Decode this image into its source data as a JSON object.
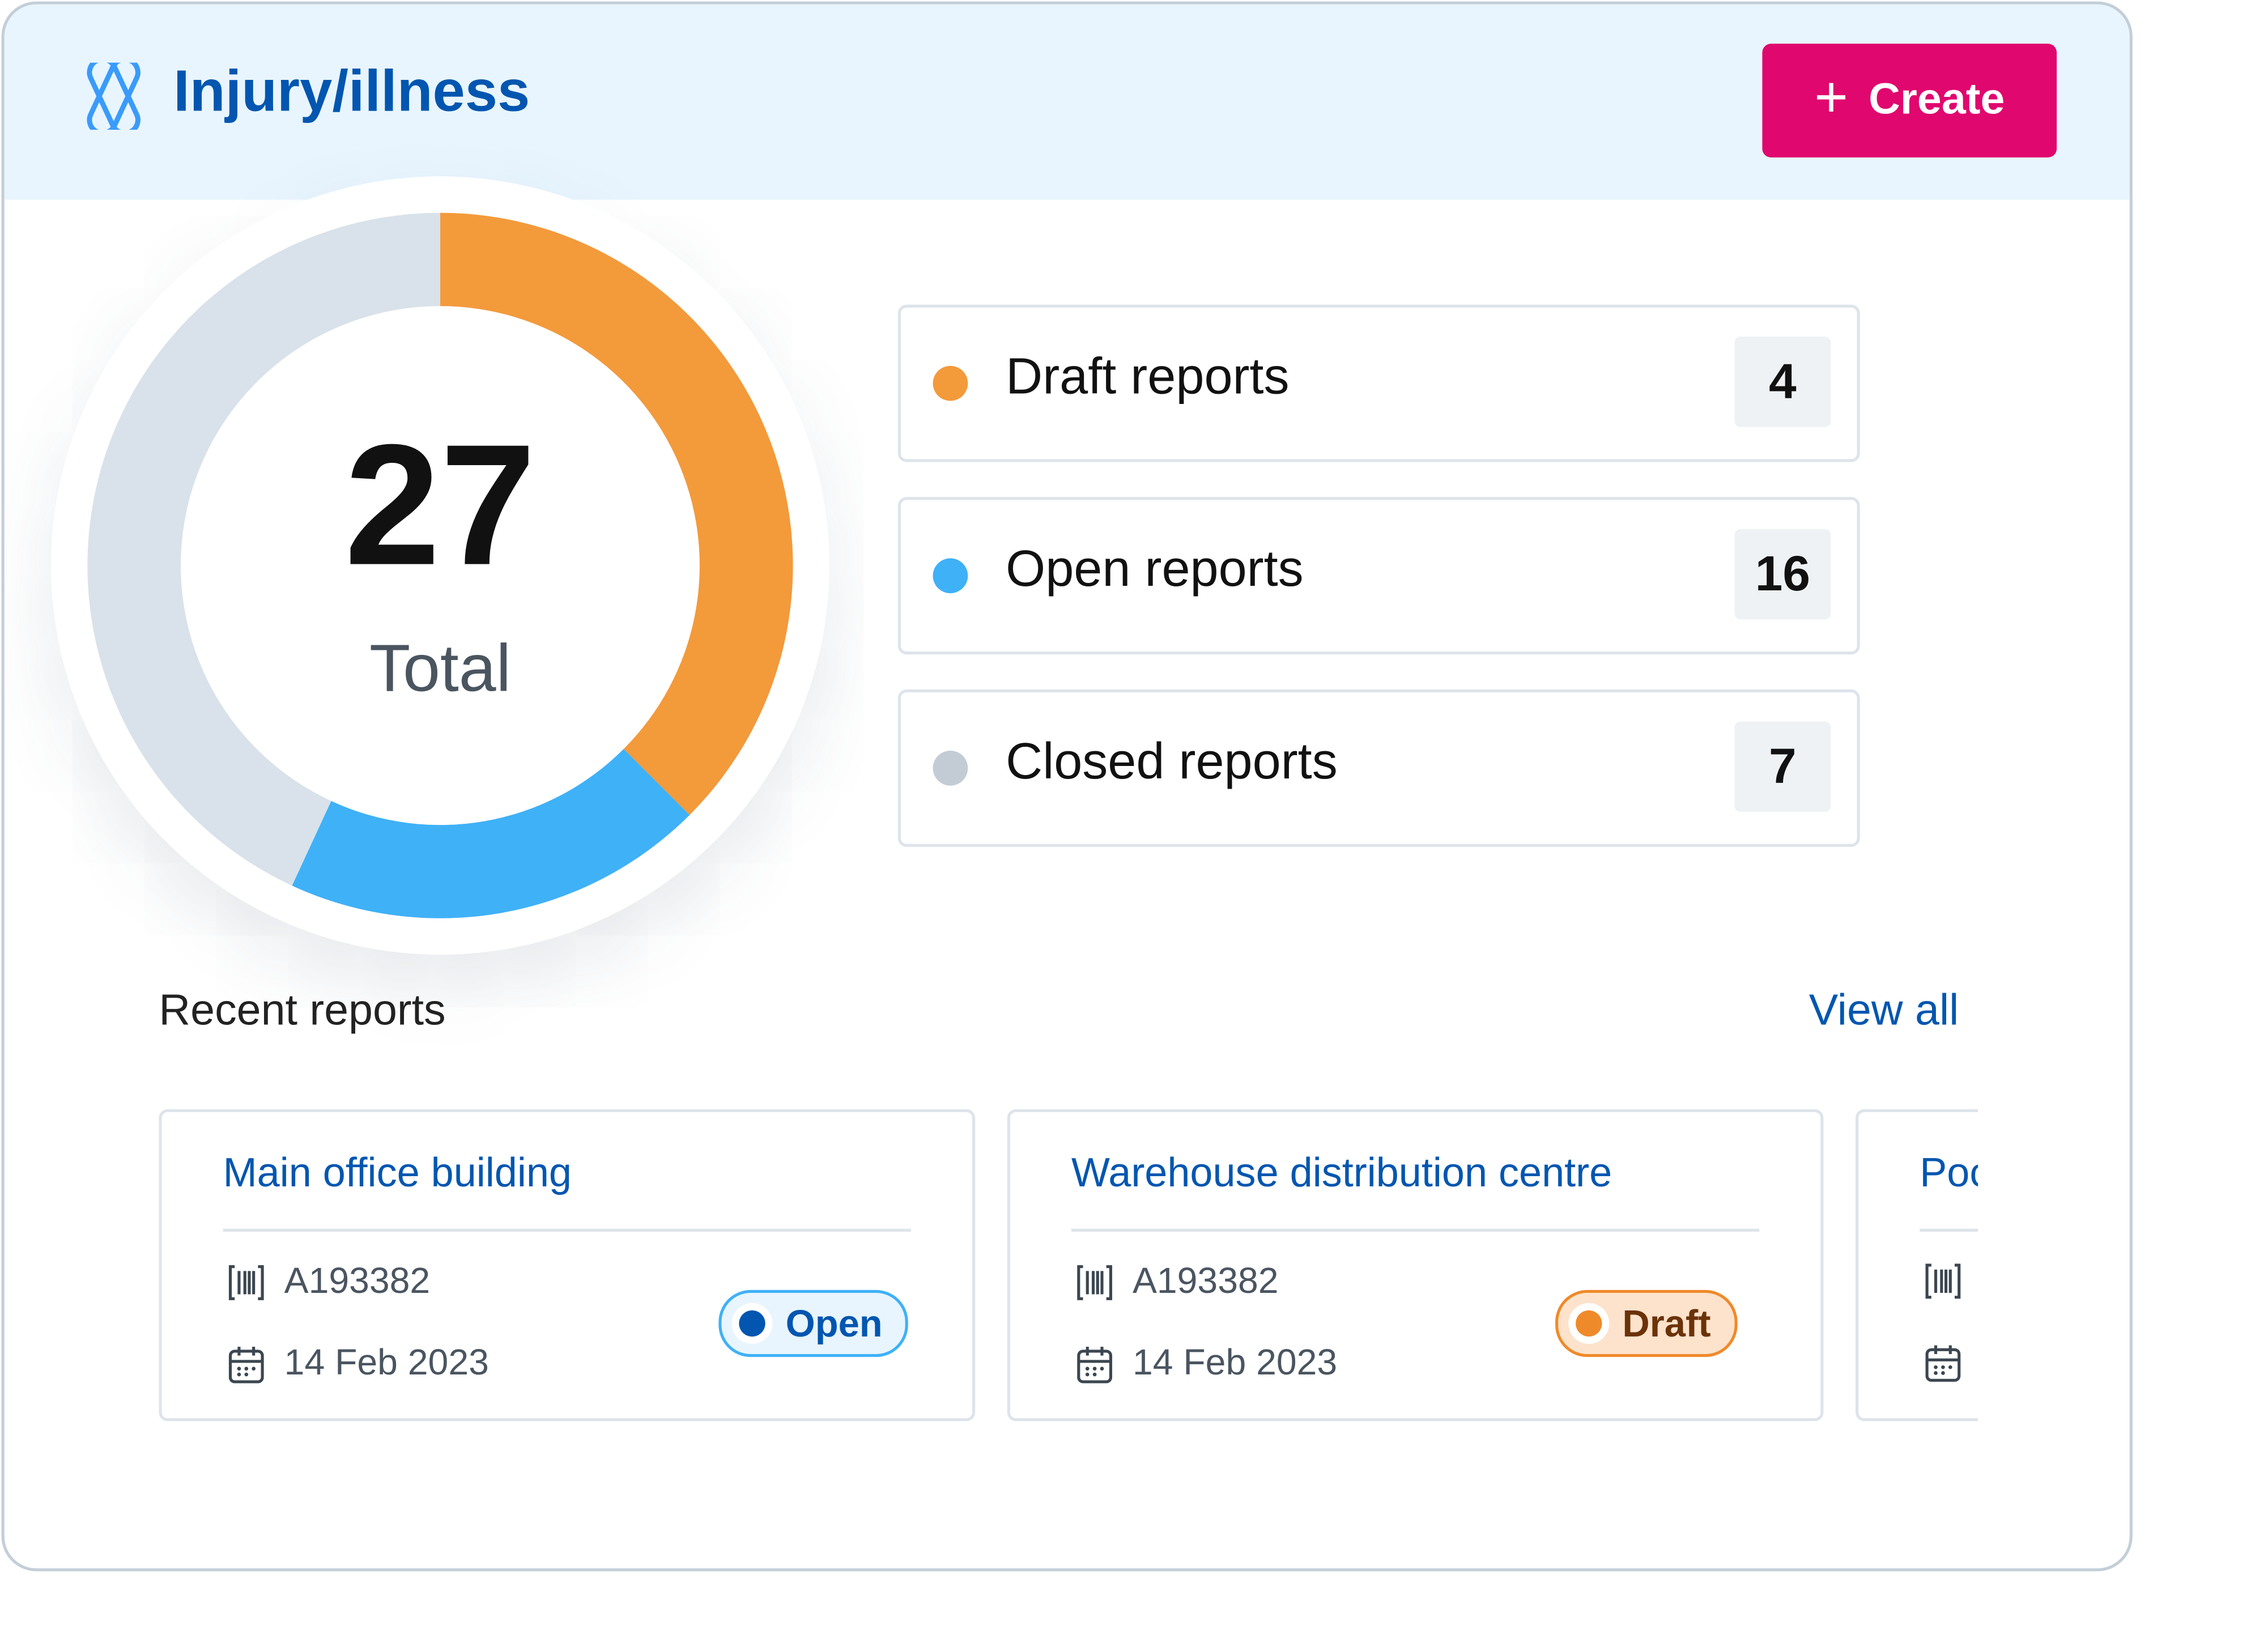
{
  "header": {
    "title": "Injury/illness",
    "logo_icon": "bandage-icon",
    "create_label": "Create",
    "create_icon": "plus-icon",
    "accent": "#e0076e",
    "title_color": "#0256b0"
  },
  "chart_data": {
    "type": "pie",
    "variant": "donut",
    "center_value": "27",
    "center_label": "Total",
    "segments": [
      {
        "name": "Draft reports",
        "color": "#f39a3b",
        "arc_fraction": 0.375
      },
      {
        "name": "Open reports",
        "color": "#3fb1f7",
        "arc_fraction": 0.194
      },
      {
        "name": "Closed reports",
        "color": "#d9e2ea",
        "arc_fraction": 0.431
      }
    ]
  },
  "stats": [
    {
      "label": "Draft reports",
      "count": "4",
      "color": "#f39a3b"
    },
    {
      "label": "Open reports",
      "count": "16",
      "color": "#3fb1f7"
    },
    {
      "label": "Closed reports",
      "count": "7",
      "color": "#c3ccd4"
    }
  ],
  "recent": {
    "title": "Recent reports",
    "view_all": "View all",
    "items": [
      {
        "name": "Main office building",
        "id": "A193382",
        "date": "14 Feb 2023",
        "status": "Open"
      },
      {
        "name": "Warehouse distribution centre",
        "id": "A193382",
        "date": "14 Feb 2023",
        "status": "Draft"
      },
      {
        "name": "Poc",
        "id": "",
        "date": "",
        "status": ""
      }
    ]
  },
  "status_colors": {
    "Open": {
      "bg": "#e8f5fe",
      "border": "#3fb1f7",
      "text": "#0256b0",
      "dot": "#0256b0"
    },
    "Draft": {
      "bg": "#fde3cc",
      "border": "#ef8a2a",
      "text": "#6b3208",
      "dot": "#ef8a2a"
    }
  }
}
